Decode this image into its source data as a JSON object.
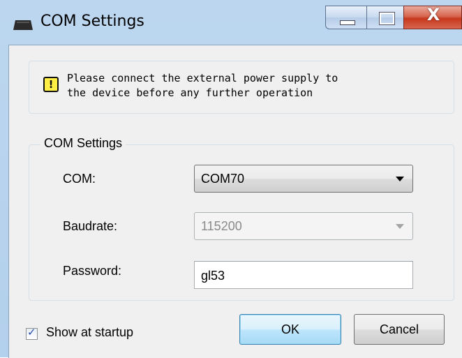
{
  "window": {
    "title": "COM Settings",
    "close_glyph": "X"
  },
  "notice": {
    "icon": "warning-icon",
    "icon_glyph": "!",
    "text": "Please connect the external power supply to\nthe device before any further operation"
  },
  "com_group": {
    "legend": "COM Settings",
    "com": {
      "label": "COM:",
      "value": "COM70"
    },
    "baudrate": {
      "label": "Baudrate:",
      "value": "115200",
      "disabled": true
    },
    "password": {
      "label": "Password:",
      "value": "gl53"
    }
  },
  "footer": {
    "show_at_startup": {
      "label": "Show at startup",
      "checked": true
    },
    "ok_label": "OK",
    "cancel_label": "Cancel"
  },
  "colors": {
    "frame": "#b9d3ee",
    "client": "#f0f0f0",
    "close_button": "#c7381d",
    "warning_fill": "#ffee44",
    "ok_border": "#3c7fb1"
  }
}
